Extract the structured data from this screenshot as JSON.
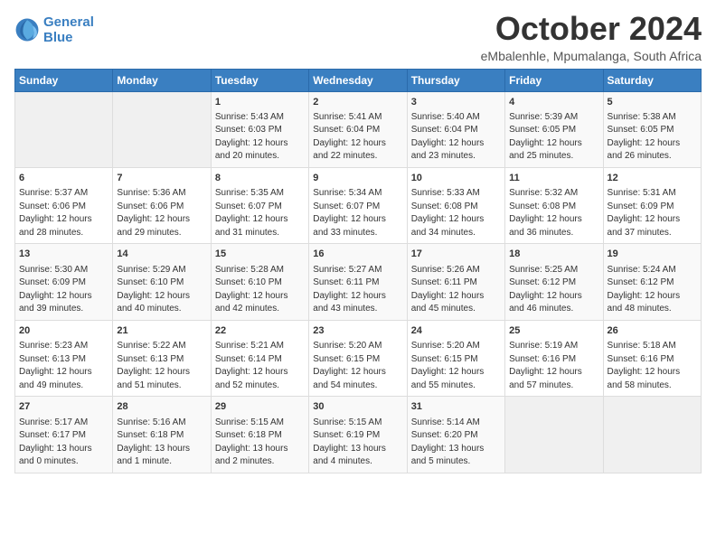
{
  "logo": {
    "line1": "General",
    "line2": "Blue"
  },
  "title": "October 2024",
  "location": "eMbalenhle, Mpumalanga, South Africa",
  "headers": [
    "Sunday",
    "Monday",
    "Tuesday",
    "Wednesday",
    "Thursday",
    "Friday",
    "Saturday"
  ],
  "rows": [
    [
      {
        "day": "",
        "info": ""
      },
      {
        "day": "",
        "info": ""
      },
      {
        "day": "1",
        "info": "Sunrise: 5:43 AM\nSunset: 6:03 PM\nDaylight: 12 hours\nand 20 minutes."
      },
      {
        "day": "2",
        "info": "Sunrise: 5:41 AM\nSunset: 6:04 PM\nDaylight: 12 hours\nand 22 minutes."
      },
      {
        "day": "3",
        "info": "Sunrise: 5:40 AM\nSunset: 6:04 PM\nDaylight: 12 hours\nand 23 minutes."
      },
      {
        "day": "4",
        "info": "Sunrise: 5:39 AM\nSunset: 6:05 PM\nDaylight: 12 hours\nand 25 minutes."
      },
      {
        "day": "5",
        "info": "Sunrise: 5:38 AM\nSunset: 6:05 PM\nDaylight: 12 hours\nand 26 minutes."
      }
    ],
    [
      {
        "day": "6",
        "info": "Sunrise: 5:37 AM\nSunset: 6:06 PM\nDaylight: 12 hours\nand 28 minutes."
      },
      {
        "day": "7",
        "info": "Sunrise: 5:36 AM\nSunset: 6:06 PM\nDaylight: 12 hours\nand 29 minutes."
      },
      {
        "day": "8",
        "info": "Sunrise: 5:35 AM\nSunset: 6:07 PM\nDaylight: 12 hours\nand 31 minutes."
      },
      {
        "day": "9",
        "info": "Sunrise: 5:34 AM\nSunset: 6:07 PM\nDaylight: 12 hours\nand 33 minutes."
      },
      {
        "day": "10",
        "info": "Sunrise: 5:33 AM\nSunset: 6:08 PM\nDaylight: 12 hours\nand 34 minutes."
      },
      {
        "day": "11",
        "info": "Sunrise: 5:32 AM\nSunset: 6:08 PM\nDaylight: 12 hours\nand 36 minutes."
      },
      {
        "day": "12",
        "info": "Sunrise: 5:31 AM\nSunset: 6:09 PM\nDaylight: 12 hours\nand 37 minutes."
      }
    ],
    [
      {
        "day": "13",
        "info": "Sunrise: 5:30 AM\nSunset: 6:09 PM\nDaylight: 12 hours\nand 39 minutes."
      },
      {
        "day": "14",
        "info": "Sunrise: 5:29 AM\nSunset: 6:10 PM\nDaylight: 12 hours\nand 40 minutes."
      },
      {
        "day": "15",
        "info": "Sunrise: 5:28 AM\nSunset: 6:10 PM\nDaylight: 12 hours\nand 42 minutes."
      },
      {
        "day": "16",
        "info": "Sunrise: 5:27 AM\nSunset: 6:11 PM\nDaylight: 12 hours\nand 43 minutes."
      },
      {
        "day": "17",
        "info": "Sunrise: 5:26 AM\nSunset: 6:11 PM\nDaylight: 12 hours\nand 45 minutes."
      },
      {
        "day": "18",
        "info": "Sunrise: 5:25 AM\nSunset: 6:12 PM\nDaylight: 12 hours\nand 46 minutes."
      },
      {
        "day": "19",
        "info": "Sunrise: 5:24 AM\nSunset: 6:12 PM\nDaylight: 12 hours\nand 48 minutes."
      }
    ],
    [
      {
        "day": "20",
        "info": "Sunrise: 5:23 AM\nSunset: 6:13 PM\nDaylight: 12 hours\nand 49 minutes."
      },
      {
        "day": "21",
        "info": "Sunrise: 5:22 AM\nSunset: 6:13 PM\nDaylight: 12 hours\nand 51 minutes."
      },
      {
        "day": "22",
        "info": "Sunrise: 5:21 AM\nSunset: 6:14 PM\nDaylight: 12 hours\nand 52 minutes."
      },
      {
        "day": "23",
        "info": "Sunrise: 5:20 AM\nSunset: 6:15 PM\nDaylight: 12 hours\nand 54 minutes."
      },
      {
        "day": "24",
        "info": "Sunrise: 5:20 AM\nSunset: 6:15 PM\nDaylight: 12 hours\nand 55 minutes."
      },
      {
        "day": "25",
        "info": "Sunrise: 5:19 AM\nSunset: 6:16 PM\nDaylight: 12 hours\nand 57 minutes."
      },
      {
        "day": "26",
        "info": "Sunrise: 5:18 AM\nSunset: 6:16 PM\nDaylight: 12 hours\nand 58 minutes."
      }
    ],
    [
      {
        "day": "27",
        "info": "Sunrise: 5:17 AM\nSunset: 6:17 PM\nDaylight: 13 hours\nand 0 minutes."
      },
      {
        "day": "28",
        "info": "Sunrise: 5:16 AM\nSunset: 6:18 PM\nDaylight: 13 hours\nand 1 minute."
      },
      {
        "day": "29",
        "info": "Sunrise: 5:15 AM\nSunset: 6:18 PM\nDaylight: 13 hours\nand 2 minutes."
      },
      {
        "day": "30",
        "info": "Sunrise: 5:15 AM\nSunset: 6:19 PM\nDaylight: 13 hours\nand 4 minutes."
      },
      {
        "day": "31",
        "info": "Sunrise: 5:14 AM\nSunset: 6:20 PM\nDaylight: 13 hours\nand 5 minutes."
      },
      {
        "day": "",
        "info": ""
      },
      {
        "day": "",
        "info": ""
      }
    ]
  ]
}
